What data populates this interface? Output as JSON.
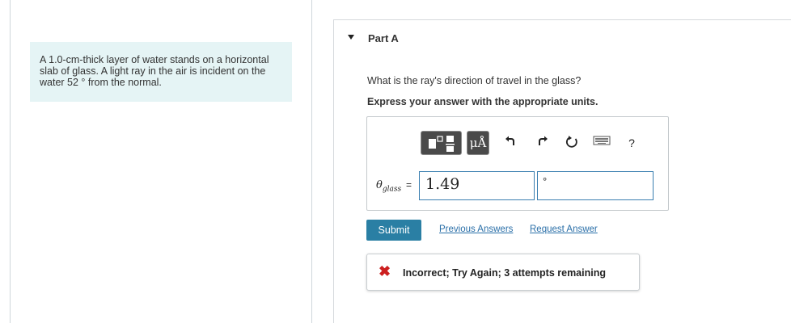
{
  "problem": {
    "line1": "A 1.0-cm-thick layer of water stands on a horizontal",
    "line2": "slab of glass. A light ray in the air is incident on the",
    "line3": "water 52 ° from the normal."
  },
  "part": {
    "label": "Part A"
  },
  "question": "What is the ray's direction of travel in the glass?",
  "instruction": "Express your answer with the appropriate units.",
  "toolbar": {
    "units_label": "μÅ",
    "help_label": "?",
    "icons": [
      "templates-icon",
      "units-icon",
      "undo-icon",
      "redo-icon",
      "reset-icon",
      "keyboard-icon",
      "help-icon"
    ]
  },
  "answer": {
    "variable": "θ",
    "subscript": "glass",
    "equals": "=",
    "value": "1.49",
    "unit": "°"
  },
  "actions": {
    "submit": "Submit",
    "previous_answers": "Previous Answers",
    "request_answer": "Request Answer"
  },
  "feedback": {
    "icon": "✖",
    "text": "Incorrect; Try Again; 3 attempts remaining"
  },
  "colors": {
    "problem_bg": "#e5f4f5",
    "submit_bg": "#2a7fa4",
    "link": "#2a6fa8",
    "error": "#cc1f1f",
    "field_border": "#3a7fb0"
  }
}
